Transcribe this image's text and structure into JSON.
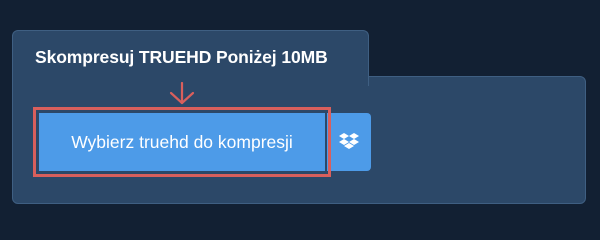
{
  "tab": {
    "title": "Skompresuj TRUEHD Poniżej 10MB"
  },
  "upload": {
    "choose_label": "Wybierz truehd do kompresji",
    "dropbox_icon": "dropbox-icon"
  },
  "colors": {
    "page_background": "#122033",
    "panel_background": "#2c4868",
    "button_background": "#4d9be8",
    "highlight_border": "#d95f5c",
    "arrow": "#d95f5c"
  }
}
